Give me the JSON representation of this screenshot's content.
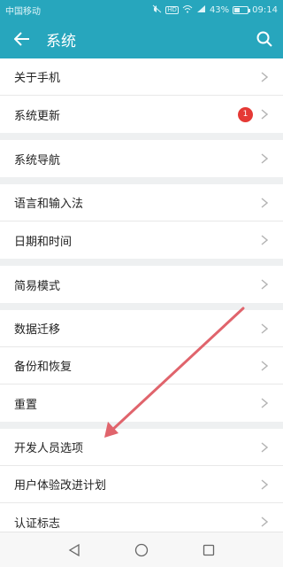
{
  "status_bar": {
    "carrier": "中国移动",
    "icons": [
      "mute-icon",
      "hd-icon",
      "wifi-icon",
      "signal-icon",
      "battery-icon"
    ],
    "hd_label": "HD",
    "battery_percent_text": "43%",
    "battery_level": 0.43,
    "time": "09:14"
  },
  "appbar": {
    "back_icon": "arrow-left-icon",
    "title": "系统",
    "search_icon": "search-icon"
  },
  "groups": [
    {
      "items": [
        {
          "label": "关于手机"
        },
        {
          "label": "系统更新",
          "badge": "1"
        }
      ]
    },
    {
      "items": [
        {
          "label": "系统导航"
        }
      ]
    },
    {
      "items": [
        {
          "label": "语言和输入法"
        },
        {
          "label": "日期和时间"
        }
      ]
    },
    {
      "items": [
        {
          "label": "简易模式"
        }
      ]
    },
    {
      "items": [
        {
          "label": "数据迁移"
        },
        {
          "label": "备份和恢复"
        },
        {
          "label": "重置"
        }
      ]
    },
    {
      "items": [
        {
          "label": "开发人员选项"
        },
        {
          "label": "用户体验改进计划"
        },
        {
          "label": "认证标志"
        }
      ]
    }
  ],
  "navbar": {
    "buttons": [
      "back-triangle-icon",
      "home-circle-icon",
      "recents-square-icon"
    ]
  },
  "colors": {
    "header": "#27a6bd",
    "badge": "#e53935",
    "arrow": "#e0646c"
  }
}
